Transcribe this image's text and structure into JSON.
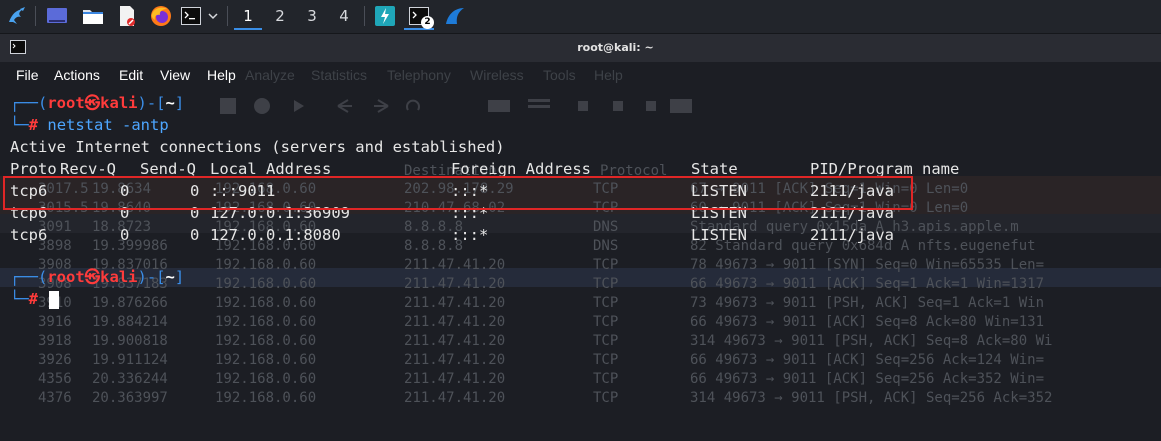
{
  "taskbar": {
    "workspaces": [
      "1",
      "2",
      "3",
      "4"
    ],
    "active_workspace": "1",
    "terminal_badge": "2"
  },
  "window": {
    "title": "root@kali: ~"
  },
  "menu": [
    "File",
    "Actions",
    "Edit",
    "View",
    "Help"
  ],
  "ghost": {
    "menu": [
      "Analyze",
      "Statistics",
      "Telephony",
      "Wireless",
      "Tools",
      "Help"
    ],
    "rows": [
      {
        "no": "3017.5",
        "time": "19.8634",
        "src": "192.168.0.60",
        "dst": "202.98.178.29",
        "proto": "TCP",
        "info": "67 → 9011 [ACK] Seq=1 Win=0 Len=0"
      },
      {
        "no": "3015.5",
        "time": "19.8640",
        "src": "192.168.0.60",
        "dst": "210.47.68.02",
        "proto": "TCP",
        "info": "60 → 9011 [ACK] Seq=1 Win=0 Len=0"
      },
      {
        "no": "3091",
        "time": "18.8723",
        "src": "192.168.0.60",
        "dst": "8.8.8.8",
        "proto": "DNS",
        "info": "Standard query 0x15da A h3.apis.apple.m"
      },
      {
        "no": "3898",
        "time": "19.399986",
        "src": "192.168.0.60",
        "dst": "8.8.8.8",
        "proto": "DNS",
        "info": "82 Standard query 0x684d A nfts.eugenefut"
      },
      {
        "no": "3908",
        "time": "19.837016",
        "src": "192.168.0.60",
        "dst": "211.47.41.20",
        "proto": "TCP",
        "info": "78 49673 → 9011 [SYN] Seq=0 Win=65535 Len="
      },
      {
        "no": "3908",
        "time": "19.837183",
        "src": "192.168.0.60",
        "dst": "211.47.41.20",
        "proto": "TCP",
        "info": "66 49673 → 9011 [ACK] Seq=1 Ack=1 Win=1317"
      },
      {
        "no": "3910",
        "time": "19.876266",
        "src": "192.168.0.60",
        "dst": "211.47.41.20",
        "proto": "TCP",
        "info": "73 49673 → 9011 [PSH, ACK] Seq=1 Ack=1 Win"
      },
      {
        "no": "3916",
        "time": "19.884214",
        "src": "192.168.0.60",
        "dst": "211.47.41.20",
        "proto": "TCP",
        "info": "66 49673 → 9011 [ACK] Seq=8 Ack=80 Win=131"
      },
      {
        "no": "3918",
        "time": "19.900818",
        "src": "192.168.0.60",
        "dst": "211.47.41.20",
        "proto": "TCP",
        "info": "314 49673 → 9011 [PSH, ACK] Seq=8 Ack=80 Wi"
      },
      {
        "no": "3926",
        "time": "19.911124",
        "src": "192.168.0.60",
        "dst": "211.47.41.20",
        "proto": "TCP",
        "info": "66 49673 → 9011 [ACK] Seq=256 Ack=124 Win="
      },
      {
        "no": "4356",
        "time": "20.336244",
        "src": "192.168.0.60",
        "dst": "211.47.41.20",
        "proto": "TCP",
        "info": "66 49673 → 9011 [ACK] Seq=256 Ack=352 Win="
      },
      {
        "no": "4376",
        "time": "20.363997",
        "src": "192.168.0.60",
        "dst": "211.47.41.20",
        "proto": "TCP",
        "info": "314 49673 → 9011 [PSH, ACK] Seq=256 Ack=352"
      }
    ]
  },
  "terminal": {
    "prompt1": {
      "user": "root",
      "host": "kali",
      "dir": "~",
      "command": "netstat -antp"
    },
    "output_header": "Active Internet connections (servers and established)",
    "columns": [
      "Proto",
      "Recv-Q",
      "Send-Q",
      "Local Address",
      "Foreign Address",
      "State",
      "PID/Program name"
    ],
    "rows": [
      {
        "proto": "tcp6",
        "recvq": "0",
        "sendq": "0",
        "local": ":::9011",
        "foreign": ":::*",
        "state": "LISTEN",
        "pid": "2111/java"
      },
      {
        "proto": "tcp6",
        "recvq": "0",
        "sendq": "0",
        "local": "127.0.0.1:36909",
        "foreign": ":::*",
        "state": "LISTEN",
        "pid": "2111/java"
      },
      {
        "proto": "tcp6",
        "recvq": "0",
        "sendq": "0",
        "local": "127.0.0.1:8080",
        "foreign": ":::*",
        "state": "LISTEN",
        "pid": "2111/java"
      }
    ],
    "prompt2": {
      "user": "root",
      "host": "kali",
      "dir": "~"
    },
    "prompt_symbol": "#",
    "skull": "㉿"
  },
  "colors": {
    "highlight": "#e02626",
    "prompt_blue": "#3b8ee8",
    "prompt_red": "#ff3b3b",
    "command": "#4da6ff"
  }
}
